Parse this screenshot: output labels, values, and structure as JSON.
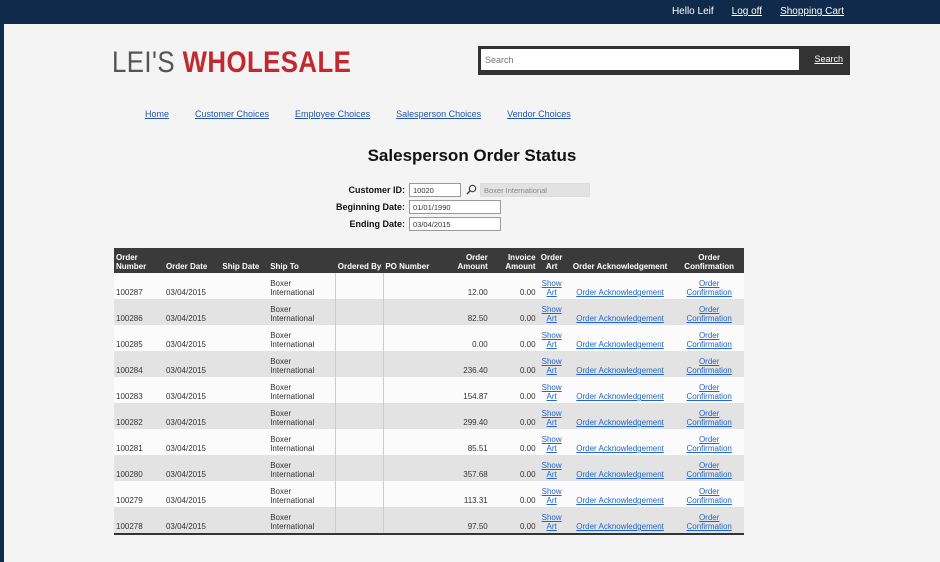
{
  "top_bar": {
    "greeting": "Hello Leif",
    "logoff": "Log off",
    "cart": "Shopping Cart"
  },
  "logo": {
    "part1": "LEI'S ",
    "part2": "WHOLESALE"
  },
  "search": {
    "placeholder": "Search",
    "button": "Search"
  },
  "nav": [
    "Home",
    "Customer Choices",
    "Employee Choices",
    "Salesperson Choices",
    "Vendor Choices"
  ],
  "page_title": "Salesperson Order Status",
  "form": {
    "customer_id_label": "Customer ID:",
    "customer_id_value": "10020",
    "customer_name": "Boxer International",
    "begin_label": "Beginning Date:",
    "begin_value": "01/01/1990",
    "end_label": "Ending Date:",
    "end_value": "03/04/2015"
  },
  "table": {
    "headers": [
      "Order Number",
      "Order Date",
      "Ship Date",
      "Ship To",
      "Ordered By",
      "PO Number",
      "Order Amount",
      "Invoice Amount",
      "Order Art",
      "Order Acknowledgement",
      "Order Confirmation"
    ],
    "rows": [
      {
        "num": "100287",
        "date": "03/04/2015",
        "ship_to": "Boxer International",
        "amount": "12.00",
        "invoice": "0.00",
        "art": "Show Art",
        "ack": "Order Acknowledgement",
        "conf": "Order Confirmation"
      },
      {
        "num": "100286",
        "date": "03/04/2015",
        "ship_to": "Boxer International",
        "amount": "82.50",
        "invoice": "0.00",
        "art": "Show Art",
        "ack": "Order Acknowledgement",
        "conf": "Order Confirmation"
      },
      {
        "num": "100285",
        "date": "03/04/2015",
        "ship_to": "Boxer International",
        "amount": "0.00",
        "invoice": "0.00",
        "art": "Show Art",
        "ack": "Order Acknowledgement",
        "conf": "Order Confirmation"
      },
      {
        "num": "100284",
        "date": "03/04/2015",
        "ship_to": "Boxer International",
        "amount": "236.40",
        "invoice": "0.00",
        "art": "Show Art",
        "ack": "Order Acknowledgement",
        "conf": "Order Confirmation"
      },
      {
        "num": "100283",
        "date": "03/04/2015",
        "ship_to": "Boxer International",
        "amount": "154.87",
        "invoice": "0.00",
        "art": "Show Art",
        "ack": "Order Acknowledgement",
        "conf": "Order Confirmation"
      },
      {
        "num": "100282",
        "date": "03/04/2015",
        "ship_to": "Boxer International",
        "amount": "299.40",
        "invoice": "0.00",
        "art": "Show Art",
        "ack": "Order Acknowledgement",
        "conf": "Order Confirmation"
      },
      {
        "num": "100281",
        "date": "03/04/2015",
        "ship_to": "Boxer International",
        "amount": "85.51",
        "invoice": "0.00",
        "art": "Show Art",
        "ack": "Order Acknowledgement",
        "conf": "Order Confirmation"
      },
      {
        "num": "100280",
        "date": "03/04/2015",
        "ship_to": "Boxer International",
        "amount": "357.68",
        "invoice": "0.00",
        "art": "Show Art",
        "ack": "Order Acknowledgement",
        "conf": "Order Confirmation"
      },
      {
        "num": "100279",
        "date": "03/04/2015",
        "ship_to": "Boxer International",
        "amount": "113.31",
        "invoice": "0.00",
        "art": "Show Art",
        "ack": "Order Acknowledgement",
        "conf": "Order Confirmation"
      },
      {
        "num": "100278",
        "date": "03/04/2015",
        "ship_to": "Boxer International",
        "amount": "97.50",
        "invoice": "0.00",
        "art": "Show Art",
        "ack": "Order Acknowledgement",
        "conf": "Order Confirmation"
      }
    ]
  },
  "colors": {
    "brand_red": "#c2282e",
    "header_dark": "#0f2a4a",
    "link_blue": "#2266cc"
  }
}
